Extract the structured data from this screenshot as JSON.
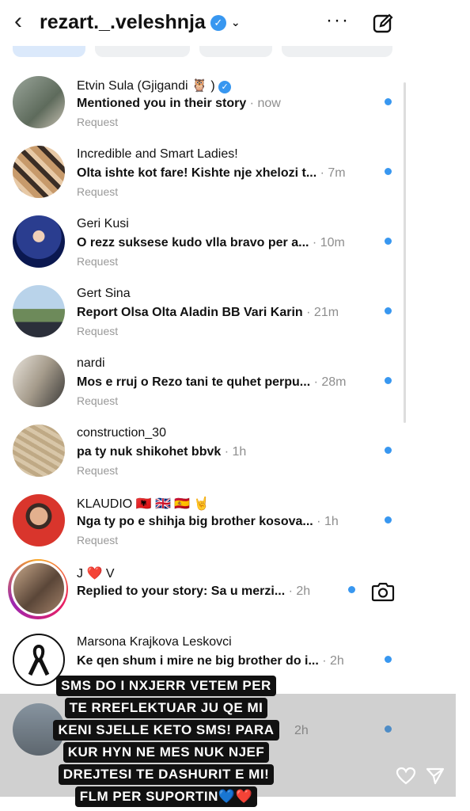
{
  "header": {
    "username": "rezart._.veleshnja",
    "back_icon": "chevron-left-icon",
    "more_label": "···"
  },
  "threads": [
    {
      "name": "Etvin Sula (Gjigandi 🦉 )",
      "verified": true,
      "message": "Mentioned you in their story",
      "time": " · now",
      "tag": "Request"
    },
    {
      "name": "Incredible and Smart Ladies!",
      "message": "Olta ishte kot fare! Kishte nje xhelozi t...",
      "time": " · 7m",
      "tag": "Request"
    },
    {
      "name": "Geri Kusi",
      "message": "O rezz suksese kudo vlla bravo per a...",
      "time": " · 10m",
      "tag": "Request"
    },
    {
      "name": "Gert Sina",
      "message": "Report Olsa Olta Aladin BB Vari Karin",
      "time": " · 21m",
      "tag": "Request"
    },
    {
      "name": "nardi",
      "message": "Mos e rruj o Rezo tani te quhet perpu...",
      "time": " · 28m",
      "tag": "Request"
    },
    {
      "name": "construction_30",
      "message": "pa ty nuk shikohet bbvk",
      "time": " · 1h",
      "tag": "Request"
    },
    {
      "name": "KLAUDIO 🇦🇱 🇬🇧 🇪🇸 🤘",
      "message": "Nga ty po e shihja big brother kosova...",
      "time": " · 1h",
      "tag": "Request"
    },
    {
      "name": "J ❤️ V",
      "message": "Replied to your story: Sa u merzi...",
      "time": " · 2h",
      "tag": ""
    },
    {
      "name": "Marsona Krajkova Leskovci",
      "message": "Ke qen shum i mire ne big brother do i...",
      "time": " · 2h",
      "tag": ""
    },
    {
      "name": "",
      "message": "",
      "time": "2h",
      "tag": ""
    }
  ],
  "story_text": {
    "line1": "SMS DO I NXJERR VETEM PER",
    "line2": "TE RREFLEKTUAR JU QE MI",
    "line3": "KENI SJELLE KETO SMS! PARA",
    "line4": "KUR HYN NE MES NUK NJEF",
    "line5": "DREJTESI TE DASHURIT E MI!",
    "line6": "FLM PER SUPORTIN💙❤️"
  },
  "colors": {
    "accent": "#3897f0",
    "text": "#111111",
    "muted": "#8e8e8e"
  }
}
